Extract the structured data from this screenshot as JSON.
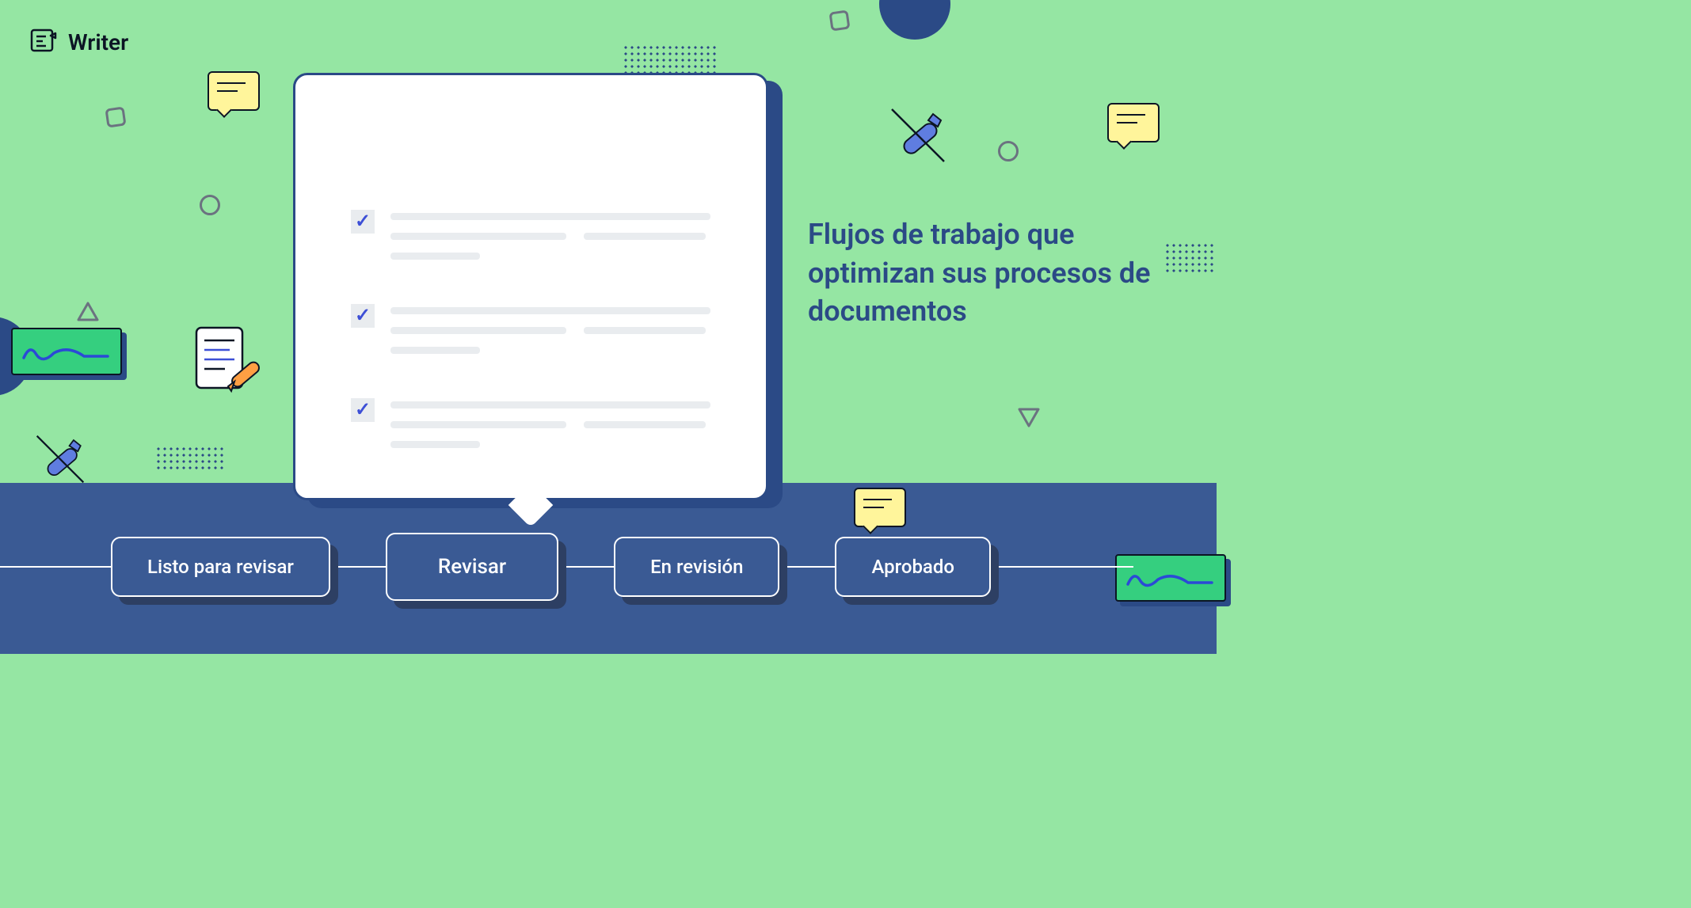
{
  "brand": {
    "name": "Writer"
  },
  "headline": "Flujos de trabajo que  optimizan sus procesos de documentos",
  "workflow": {
    "steps": [
      {
        "label": "Listo para revisar",
        "active": false
      },
      {
        "label": "Revisar",
        "active": true
      },
      {
        "label": "En revisión",
        "active": false
      },
      {
        "label": "Aprobado",
        "active": false
      }
    ]
  },
  "colors": {
    "bg_green": "#95e6a3",
    "panel_blue": "#3a5a94",
    "accent_blue": "#2b4a86",
    "sticky_yellow": "#fff59b",
    "sig_green": "#35cf7f"
  }
}
